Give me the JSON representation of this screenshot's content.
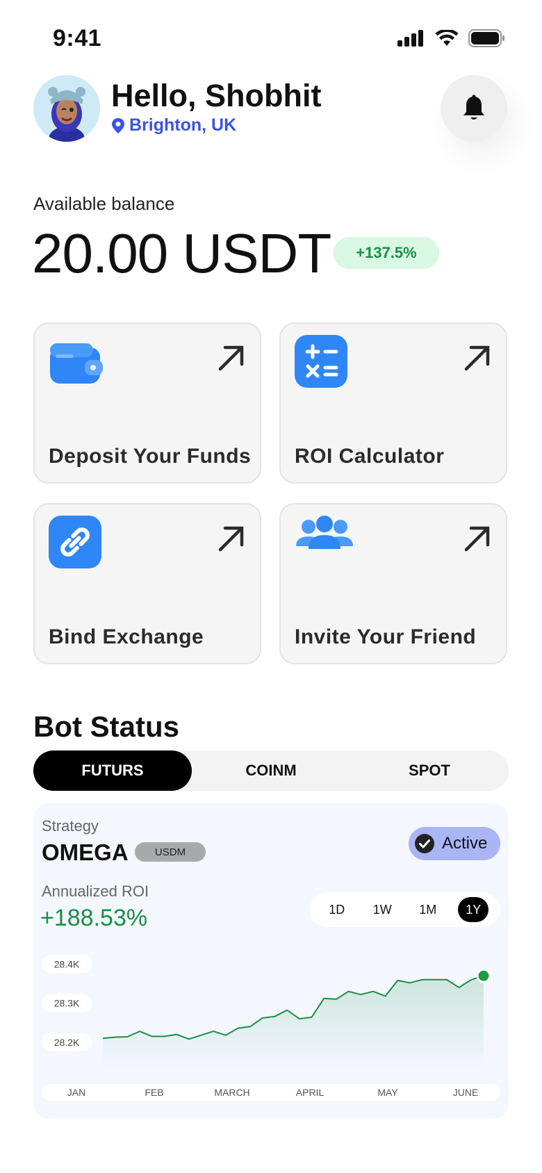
{
  "status_bar": {
    "time": "9:41"
  },
  "header": {
    "greeting": "Hello, Shobhit",
    "location": "Brighton, UK"
  },
  "balance": {
    "label": "Available balance",
    "value": "20.00 USDT",
    "change": "+137.5%"
  },
  "actions": [
    {
      "label": "Deposit Your Funds",
      "icon": "wallet-icon"
    },
    {
      "label": "ROI Calculator",
      "icon": "calculator-icon"
    },
    {
      "label": "Bind Exchange",
      "icon": "link-icon"
    },
    {
      "label": "Invite Your Friend",
      "icon": "people-icon"
    }
  ],
  "bot_status": {
    "title": "Bot Status",
    "tabs": [
      "FUTURS",
      "COINM",
      "SPOT"
    ],
    "active_tab": "FUTURS",
    "strategy_label": "Strategy",
    "strategy_name": "OMEGA",
    "strategy_badge": "USDM",
    "status": "Active",
    "roi_label": "Annualized ROI",
    "roi_value": "+188.53%",
    "ranges": [
      "1D",
      "1W",
      "1M",
      "1Y"
    ],
    "active_range": "1Y"
  },
  "colors": {
    "accent": "#3b53e6",
    "positive": "#1a8f46",
    "icon_blue": "#2f86f6"
  },
  "chart_data": {
    "type": "area",
    "x": [
      "JAN",
      "FEB",
      "MARCH",
      "APRIL",
      "MAY",
      "JUNE"
    ],
    "y_ticks": [
      "28.4K",
      "28.3K",
      "28.2K"
    ],
    "ylim": [
      28150,
      28420
    ],
    "series": [
      {
        "values": [
          28210,
          28213,
          28214,
          28228,
          28215,
          28215,
          28220,
          28208,
          28218,
          28228,
          28218,
          28236,
          28240,
          28262,
          28266,
          28282,
          28260,
          28264,
          28312,
          28310,
          28330,
          28322,
          28330,
          28318,
          28358,
          28352,
          28360,
          28360,
          28360,
          28340,
          28360,
          28370
        ]
      }
    ],
    "grid": false,
    "legend": "none"
  }
}
